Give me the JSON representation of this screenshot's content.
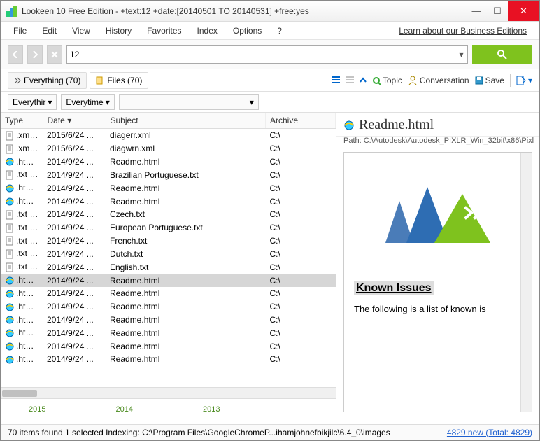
{
  "title": "Lookeen 10 Free Edition - +text:12 +date:[20140501 TO 20140531] +free:yes",
  "menu": [
    "File",
    "Edit",
    "View",
    "History",
    "Favorites",
    "Index",
    "Options",
    "?"
  ],
  "business_link": "Learn about our Business Editions",
  "search_value": "12",
  "tabs": {
    "everything": "Everything (70)",
    "files": "Files (70)"
  },
  "toolbar": {
    "topic": "Topic",
    "conversation": "Conversation",
    "save": "Save"
  },
  "filters": {
    "everything": "Everythir",
    "everytime": "Everytime"
  },
  "columns": {
    "type": "Type",
    "date": "Date",
    "subject": "Subject",
    "archive": "Archive"
  },
  "rows": [
    {
      "type": ".xml File",
      "date": "2015/6/24 ...",
      "subject": "diagerr.xml",
      "archive": "C:\\",
      "icon": "xml"
    },
    {
      "type": ".xml File",
      "date": "2015/6/24 ...",
      "subject": "diagwrn.xml",
      "archive": "C:\\",
      "icon": "xml"
    },
    {
      "type": ".html ...",
      "date": "2014/9/24 ...",
      "subject": "Readme.html",
      "archive": "C:\\",
      "icon": "html"
    },
    {
      "type": ".txt File",
      "date": "2014/9/24 ...",
      "subject": "Brazilian Portuguese.txt",
      "archive": "C:\\",
      "icon": "txt"
    },
    {
      "type": ".html ...",
      "date": "2014/9/24 ...",
      "subject": "Readme.html",
      "archive": "C:\\",
      "icon": "html"
    },
    {
      "type": ".html ...",
      "date": "2014/9/24 ...",
      "subject": "Readme.html",
      "archive": "C:\\",
      "icon": "html"
    },
    {
      "type": ".txt File",
      "date": "2014/9/24 ...",
      "subject": "Czech.txt",
      "archive": "C:\\",
      "icon": "txt"
    },
    {
      "type": ".txt File",
      "date": "2014/9/24 ...",
      "subject": "European Portuguese.txt",
      "archive": "C:\\",
      "icon": "txt"
    },
    {
      "type": ".txt File",
      "date": "2014/9/24 ...",
      "subject": "French.txt",
      "archive": "C:\\",
      "icon": "txt"
    },
    {
      "type": ".txt File",
      "date": "2014/9/24 ...",
      "subject": "Dutch.txt",
      "archive": "C:\\",
      "icon": "txt"
    },
    {
      "type": ".txt File",
      "date": "2014/9/24 ...",
      "subject": "English.txt",
      "archive": "C:\\",
      "icon": "txt"
    },
    {
      "type": ".html ...",
      "date": "2014/9/24 ...",
      "subject": "Readme.html",
      "archive": "C:\\",
      "icon": "html",
      "selected": true
    },
    {
      "type": ".html ...",
      "date": "2014/9/24 ...",
      "subject": "Readme.html",
      "archive": "C:\\",
      "icon": "html"
    },
    {
      "type": ".html ...",
      "date": "2014/9/24 ...",
      "subject": "Readme.html",
      "archive": "C:\\",
      "icon": "html"
    },
    {
      "type": ".html ...",
      "date": "2014/9/24 ...",
      "subject": "Readme.html",
      "archive": "C:\\",
      "icon": "html"
    },
    {
      "type": ".html ...",
      "date": "2014/9/24 ...",
      "subject": "Readme.html",
      "archive": "C:\\",
      "icon": "html"
    },
    {
      "type": ".html ...",
      "date": "2014/9/24 ...",
      "subject": "Readme.html",
      "archive": "C:\\",
      "icon": "html"
    },
    {
      "type": ".html ...",
      "date": "2014/9/24 ...",
      "subject": "Readme.html",
      "archive": "C:\\",
      "icon": "html"
    }
  ],
  "timeline": [
    "2015",
    "2014",
    "2013"
  ],
  "preview": {
    "title": "Readme.html",
    "path": "Path: C:\\Autodesk\\Autodesk_PIXLR_Win_32bit\\x86\\Pixl",
    "heading": "Known Issues",
    "body": "The following is a list of known is"
  },
  "status": {
    "left": "70 items found  1 selected  Indexing: C:\\Program Files\\GoogleChromeP...ihamjohnefbikjilc\\6.4_0\\images",
    "right_link": "4829 new (Total: 4829)"
  }
}
